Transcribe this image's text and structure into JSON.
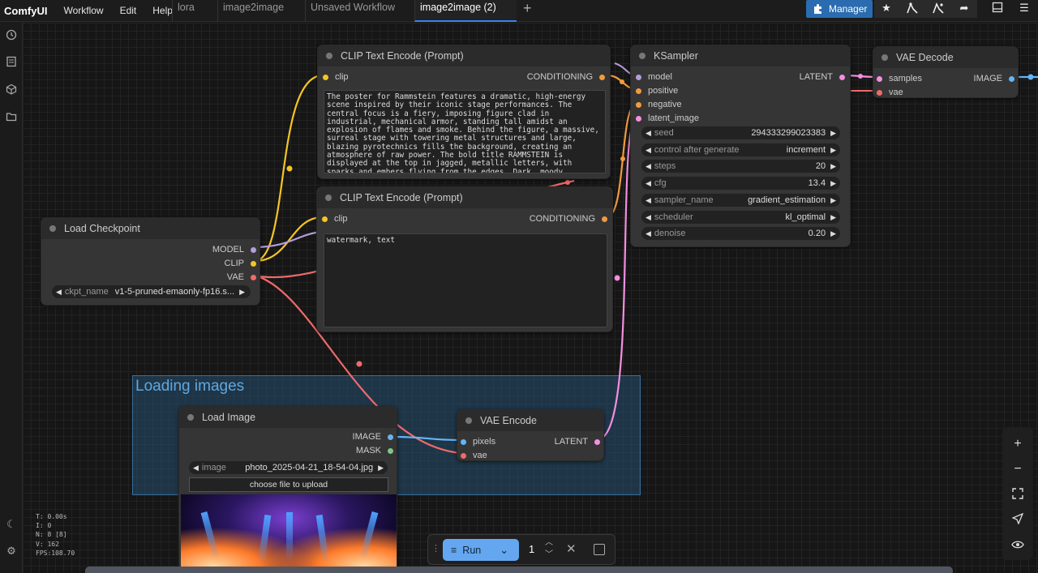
{
  "app": {
    "logo": "ComfyUI"
  },
  "menu": [
    "Workflow",
    "Edit",
    "Help"
  ],
  "tabs": [
    "lora",
    "image2image",
    "Unsaved Workflow",
    "image2image (2)"
  ],
  "active_tab": "image2image (2)",
  "toolbar": {
    "manager_label": "Manager",
    "icons": [
      "star-icon",
      "node-icon",
      "node-alt-icon",
      "share-icon",
      "panel-icon",
      "hamburger-icon"
    ]
  },
  "group": {
    "title": "Loading images"
  },
  "nodes": {
    "clip_pos": {
      "title": "CLIP Text Encode (Prompt)",
      "input": "clip",
      "output": "CONDITIONING",
      "text": "The poster for Rammstein features a dramatic, high-energy scene inspired by their iconic stage performances. The central focus is a fiery, imposing figure clad in industrial, mechanical armor, standing tall amidst an explosion of flames and smoke. Behind the figure, a massive, surreal stage with towering metal structures and large, blazing pyrotechnics fills the background, creating an atmosphere of raw power. The bold title RAMMSTEIN is displayed at the top in jagged, metallic letters, with sparks and embers flying from the edges. Dark, moody lighting and a heavy, metallic color palette dominate the design, perfectly capturing the intensity of"
    },
    "clip_neg": {
      "title": "CLIP Text Encode (Prompt)",
      "input": "clip",
      "output": "CONDITIONING",
      "text": "watermark, text"
    },
    "ksampler": {
      "title": "KSampler",
      "inputs": [
        "model",
        "positive",
        "negative",
        "latent_image"
      ],
      "output": "LATENT",
      "widgets": [
        {
          "name": "seed",
          "value": "294333299023383"
        },
        {
          "name": "control after generate",
          "value": "increment"
        },
        {
          "name": "steps",
          "value": "20"
        },
        {
          "name": "cfg",
          "value": "13.4"
        },
        {
          "name": "sampler_name",
          "value": "gradient_estimation"
        },
        {
          "name": "scheduler",
          "value": "kl_optimal"
        },
        {
          "name": "denoise",
          "value": "0.20"
        }
      ]
    },
    "vae_decode": {
      "title": "VAE Decode",
      "inputs": [
        "samples",
        "vae"
      ],
      "output": "IMAGE"
    },
    "checkpoint": {
      "title": "Load Checkpoint",
      "outputs": [
        "MODEL",
        "CLIP",
        "VAE"
      ],
      "widget": {
        "name": "ckpt_name",
        "value": "v1-5-pruned-emaonly-fp16.s..."
      }
    },
    "load_image": {
      "title": "Load Image",
      "outputs": [
        "IMAGE",
        "MASK"
      ],
      "widget": {
        "name": "image",
        "value": "photo_2025-04-21_18-54-04.jpg"
      },
      "upload_label": "choose file to upload"
    },
    "vae_encode": {
      "title": "VAE Encode",
      "inputs": [
        "pixels",
        "vae"
      ],
      "output": "LATENT"
    }
  },
  "stats": [
    "T: 0.00s",
    "I: 0",
    "N: 8 [8]",
    "V: 162",
    "FPS:108.70"
  ],
  "runbar": {
    "run_label": "Run",
    "count": "1"
  },
  "colors": {
    "clip": "#f6c523",
    "conditioning": "#f29b3b",
    "model": "#b39ddb",
    "vae": "#f06a6a",
    "latent": "#f48fe0",
    "image": "#64b5f6",
    "mask": "#81c784"
  }
}
